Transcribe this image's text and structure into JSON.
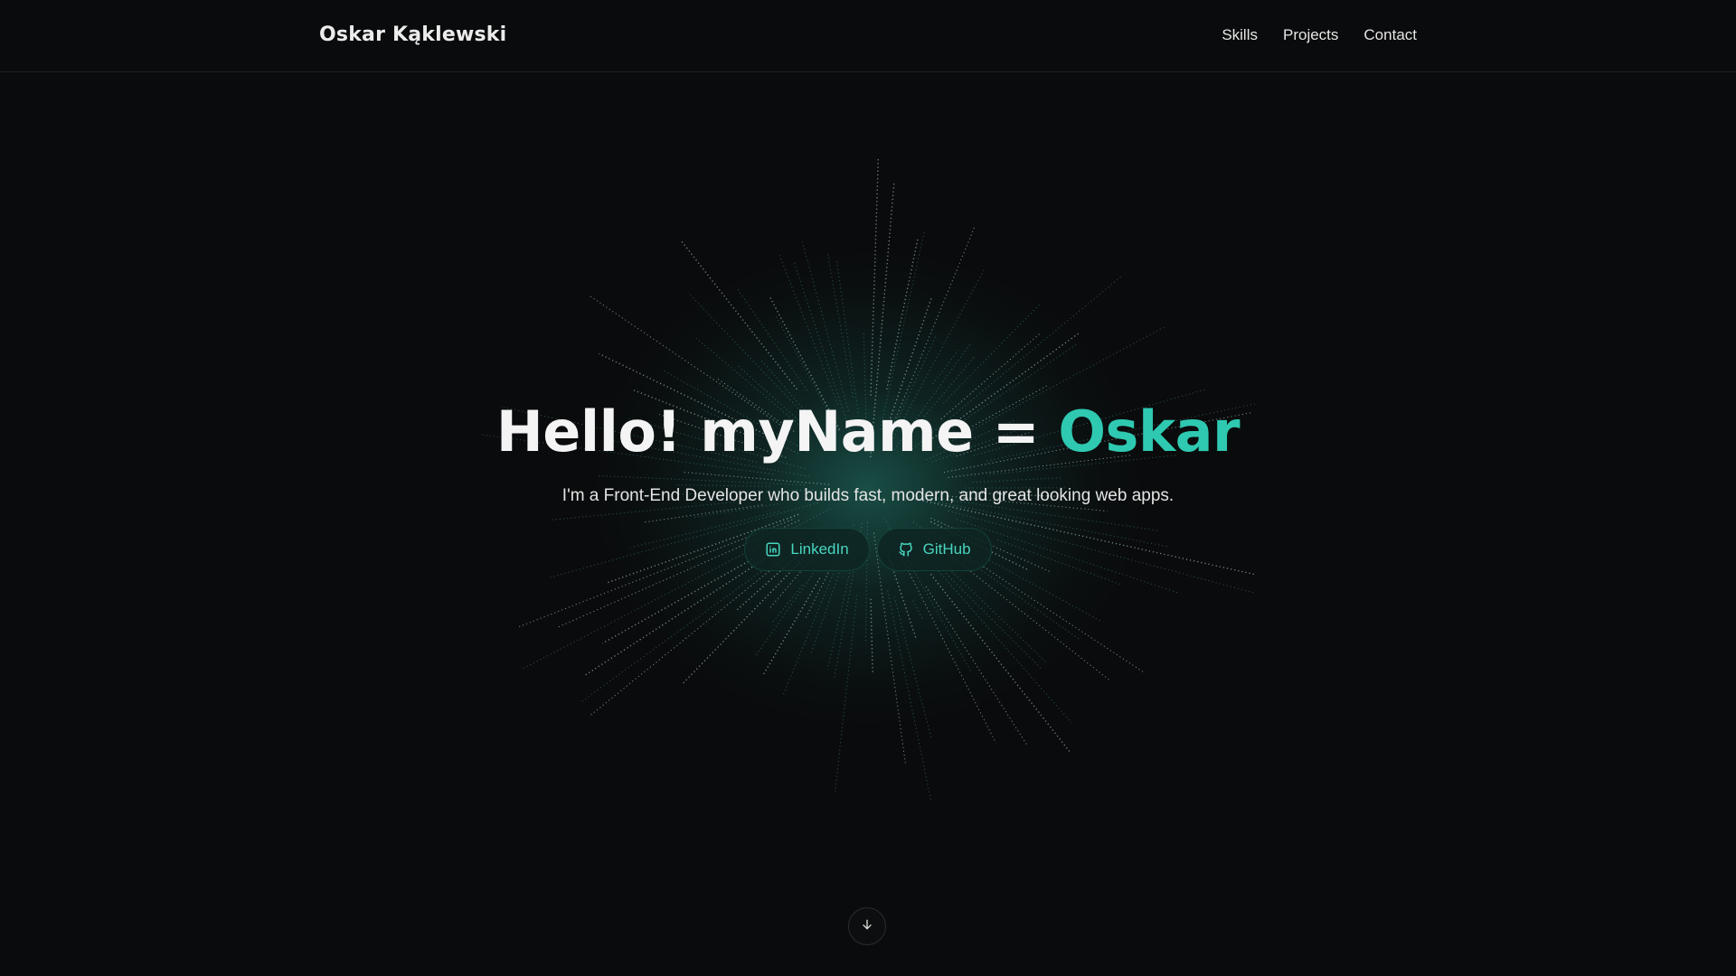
{
  "header": {
    "brand": "Oskar Kąklewski",
    "nav": [
      {
        "label": "Skills"
      },
      {
        "label": "Projects"
      },
      {
        "label": "Contact"
      }
    ]
  },
  "hero": {
    "title_prefix": "Hello! myName = ",
    "title_name": "Oskar",
    "subtitle": "I'm a Front-End Developer who builds fast, modern, and great looking web apps.",
    "buttons": [
      {
        "label": "LinkedIn",
        "icon": "linkedin-icon"
      },
      {
        "label": "GitHub",
        "icon": "github-icon"
      }
    ]
  },
  "scroll": {
    "icon": "arrow-down-icon"
  },
  "colors": {
    "background": "#0a0b0c",
    "accent": "#2ec9b0",
    "button_text": "#47d6bf"
  }
}
